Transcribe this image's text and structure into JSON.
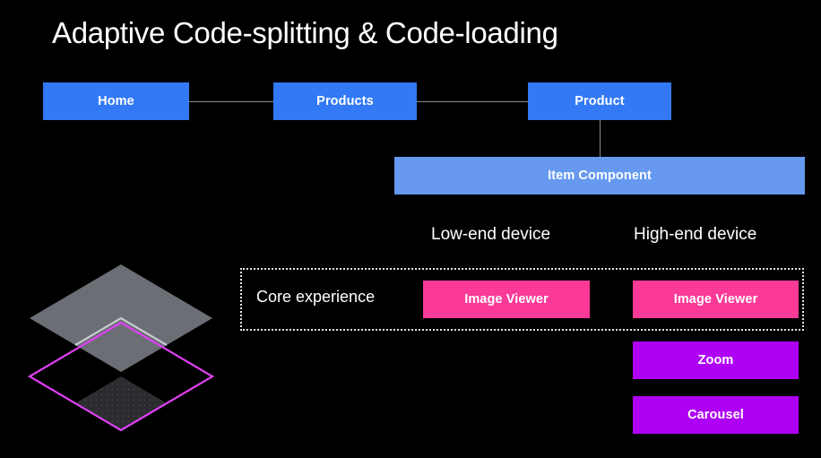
{
  "page": {
    "background_color": "#000000",
    "title": "Adaptive Code-splitting & Code-loading"
  },
  "colors": {
    "blue": "#3379f6",
    "light_blue": "#6699ef",
    "pink": "#fb3a97",
    "purple": "#ad00f5",
    "connector": "#8b8b8b",
    "dotted_border": "#e6e6e6",
    "diamond_gray": "#6b6e75",
    "diamond_gray_dark": "#333338",
    "diamond_magenta": "#e040f5",
    "diamond_edge_light": "#c9c9cf"
  },
  "route_tree": {
    "nodes": [
      {
        "id": "home",
        "label": "Home"
      },
      {
        "id": "products",
        "label": "Products"
      },
      {
        "id": "product",
        "label": "Product"
      },
      {
        "id": "item_component",
        "label": "Item Component"
      }
    ]
  },
  "matrix": {
    "column_headers": [
      {
        "id": "low",
        "label": "Low-end device"
      },
      {
        "id": "high",
        "label": "High-end device"
      }
    ],
    "core_row_label": "Core experience",
    "core_row_chips": [
      {
        "column": "low",
        "label": "Image Viewer",
        "color": "pink"
      },
      {
        "column": "high",
        "label": "Image Viewer",
        "color": "pink"
      }
    ],
    "enhancement_chips": [
      {
        "column": "high",
        "label": "Zoom",
        "color": "purple"
      },
      {
        "column": "high",
        "label": "Carousel",
        "color": "purple"
      }
    ]
  },
  "artwork": {
    "name": "layered-isometric-diamonds",
    "layers": [
      {
        "id": "upper",
        "style": "filled-gray"
      },
      {
        "id": "lower",
        "style": "magenta-outline"
      },
      {
        "id": "overlap",
        "style": "dark-gray-dotted"
      }
    ]
  }
}
